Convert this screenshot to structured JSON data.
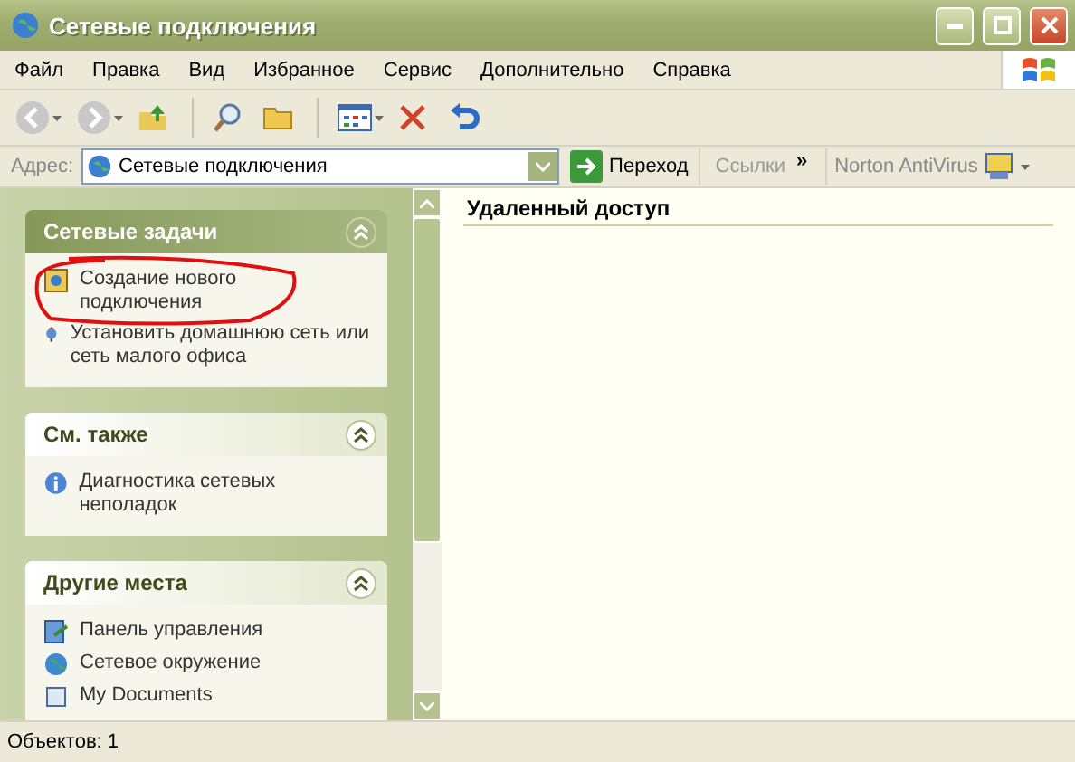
{
  "window": {
    "title": "Сетевые подключения"
  },
  "menu": [
    "Файл",
    "Правка",
    "Вид",
    "Избранное",
    "Сервис",
    "Дополнительно",
    "Справка"
  ],
  "toolbar": {
    "back_disabled": true,
    "forward_disabled": true
  },
  "address": {
    "label": "Адрес:",
    "value": "Сетевые подключения",
    "go": "Переход",
    "links": "Ссылки",
    "chevron": "»",
    "norton": "Norton AntiVirus"
  },
  "task_panels": [
    {
      "title": "Сетевые задачи",
      "kind": "primary",
      "items": [
        {
          "text": "Создание нового подключения",
          "circled": true
        },
        {
          "text": "Установить домашнюю сеть или сеть малого офиса",
          "circled": false
        }
      ]
    },
    {
      "title": "См. также",
      "kind": "normal",
      "items": [
        {
          "text": "Диагностика сетевых неполадок",
          "circled": false
        }
      ]
    },
    {
      "title": "Другие места",
      "kind": "normal",
      "items": [
        {
          "text": "Панель управления",
          "circled": false
        },
        {
          "text": "Сетевое окружение",
          "circled": false
        },
        {
          "text": "My Documents",
          "circled": false
        }
      ]
    }
  ],
  "content": {
    "group_header": "Удаленный доступ"
  },
  "status_bar": {
    "text": "Объектов: 1"
  }
}
